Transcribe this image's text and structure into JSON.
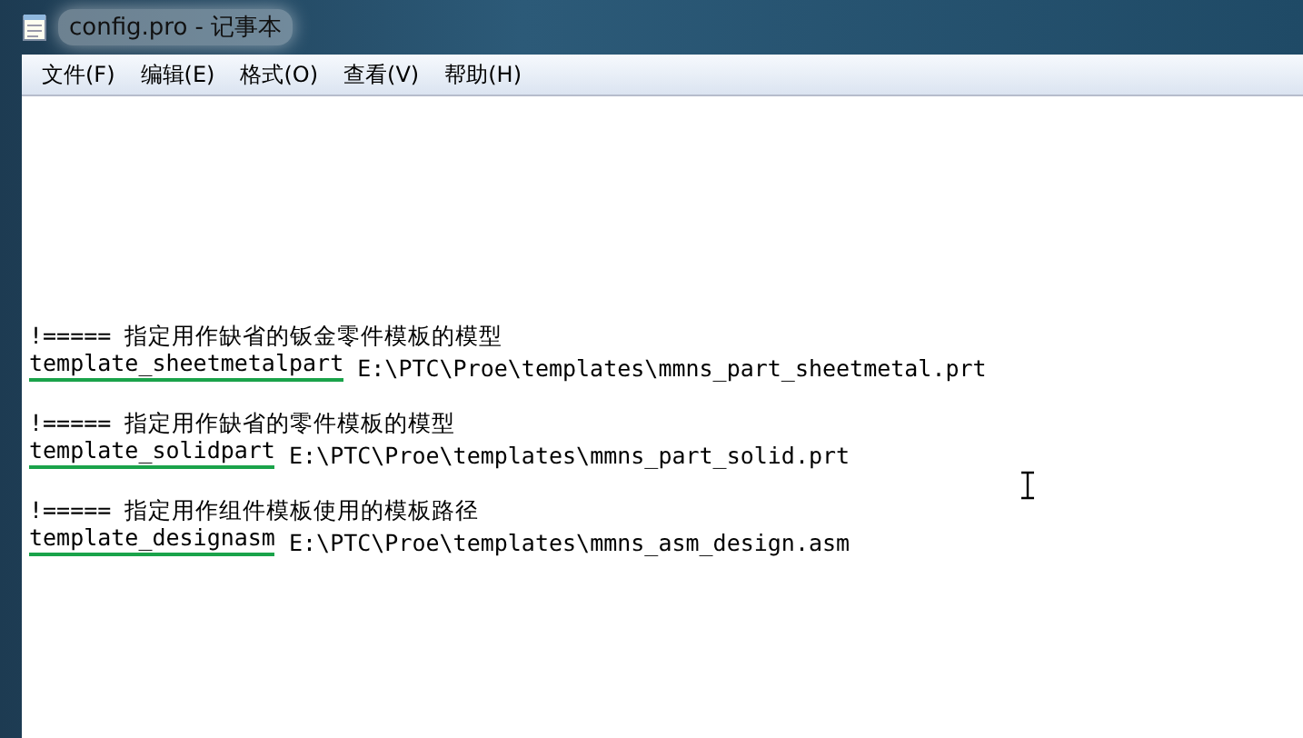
{
  "window": {
    "title": "config.pro - 记事本"
  },
  "menu": [
    "文件(F)",
    "编辑(E)",
    "格式(O)",
    "查看(V)",
    "帮助(H)"
  ],
  "lines": [
    {
      "kind": "comment",
      "text": "!===== 指定用作缺省的钣金零件模板的模型"
    },
    {
      "kind": "setting",
      "key": "template_sheetmetalpart",
      "value": "E:\\PTC\\Proe\\templates\\mmns_part_sheetmetal.prt",
      "underlined": true
    },
    {
      "kind": "blank"
    },
    {
      "kind": "comment",
      "text": "!===== 指定用作缺省的零件模板的模型"
    },
    {
      "kind": "setting",
      "key": "template_solidpart",
      "value": "E:\\PTC\\Proe\\templates\\mmns_part_solid.prt",
      "underlined": true
    },
    {
      "kind": "blank"
    },
    {
      "kind": "comment",
      "text": "!===== 指定用作组件模板使用的模板路径"
    },
    {
      "kind": "setting",
      "key": "template_designasm",
      "value": "E:\\PTC\\Proe\\templates\\mmns_asm_design.asm",
      "underlined": true
    }
  ]
}
